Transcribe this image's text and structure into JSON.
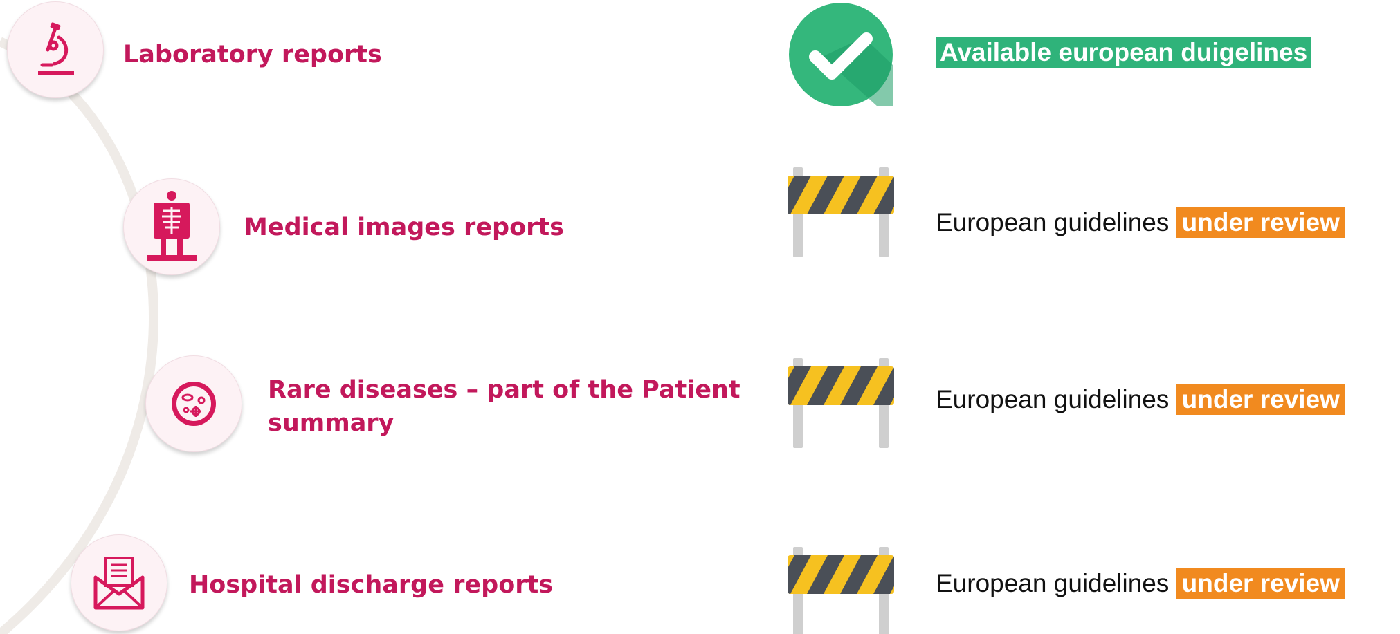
{
  "rows": [
    {
      "label": "Laboratory reports",
      "icon": "microscope-icon",
      "status_icon": "checkmark-icon",
      "status_highlight": "Available european duigelines"
    },
    {
      "label": "Medical images reports",
      "icon": "xray-icon",
      "status_icon": "barrier-icon",
      "status_text": "European guidelines",
      "status_highlight": "under review"
    },
    {
      "label": "Rare diseases – part of the Patient summary",
      "icon": "petri-dish-icon",
      "status_icon": "barrier-icon",
      "status_text": "European guidelines",
      "status_highlight": "under review"
    },
    {
      "label": "Hospital discharge reports",
      "icon": "envelope-document-icon",
      "status_icon": "barrier-icon",
      "status_text": "European guidelines",
      "status_highlight": "under review"
    }
  ],
  "colors": {
    "label": "#c2185b",
    "icon": "#d6195c",
    "available": "#2fb37a",
    "under_review": "#f18a1f",
    "barrier_yellow": "#f6c120",
    "barrier_stripe": "#4a4f57",
    "barrier_post": "#cfcfcf",
    "arc": "#efebe7"
  }
}
